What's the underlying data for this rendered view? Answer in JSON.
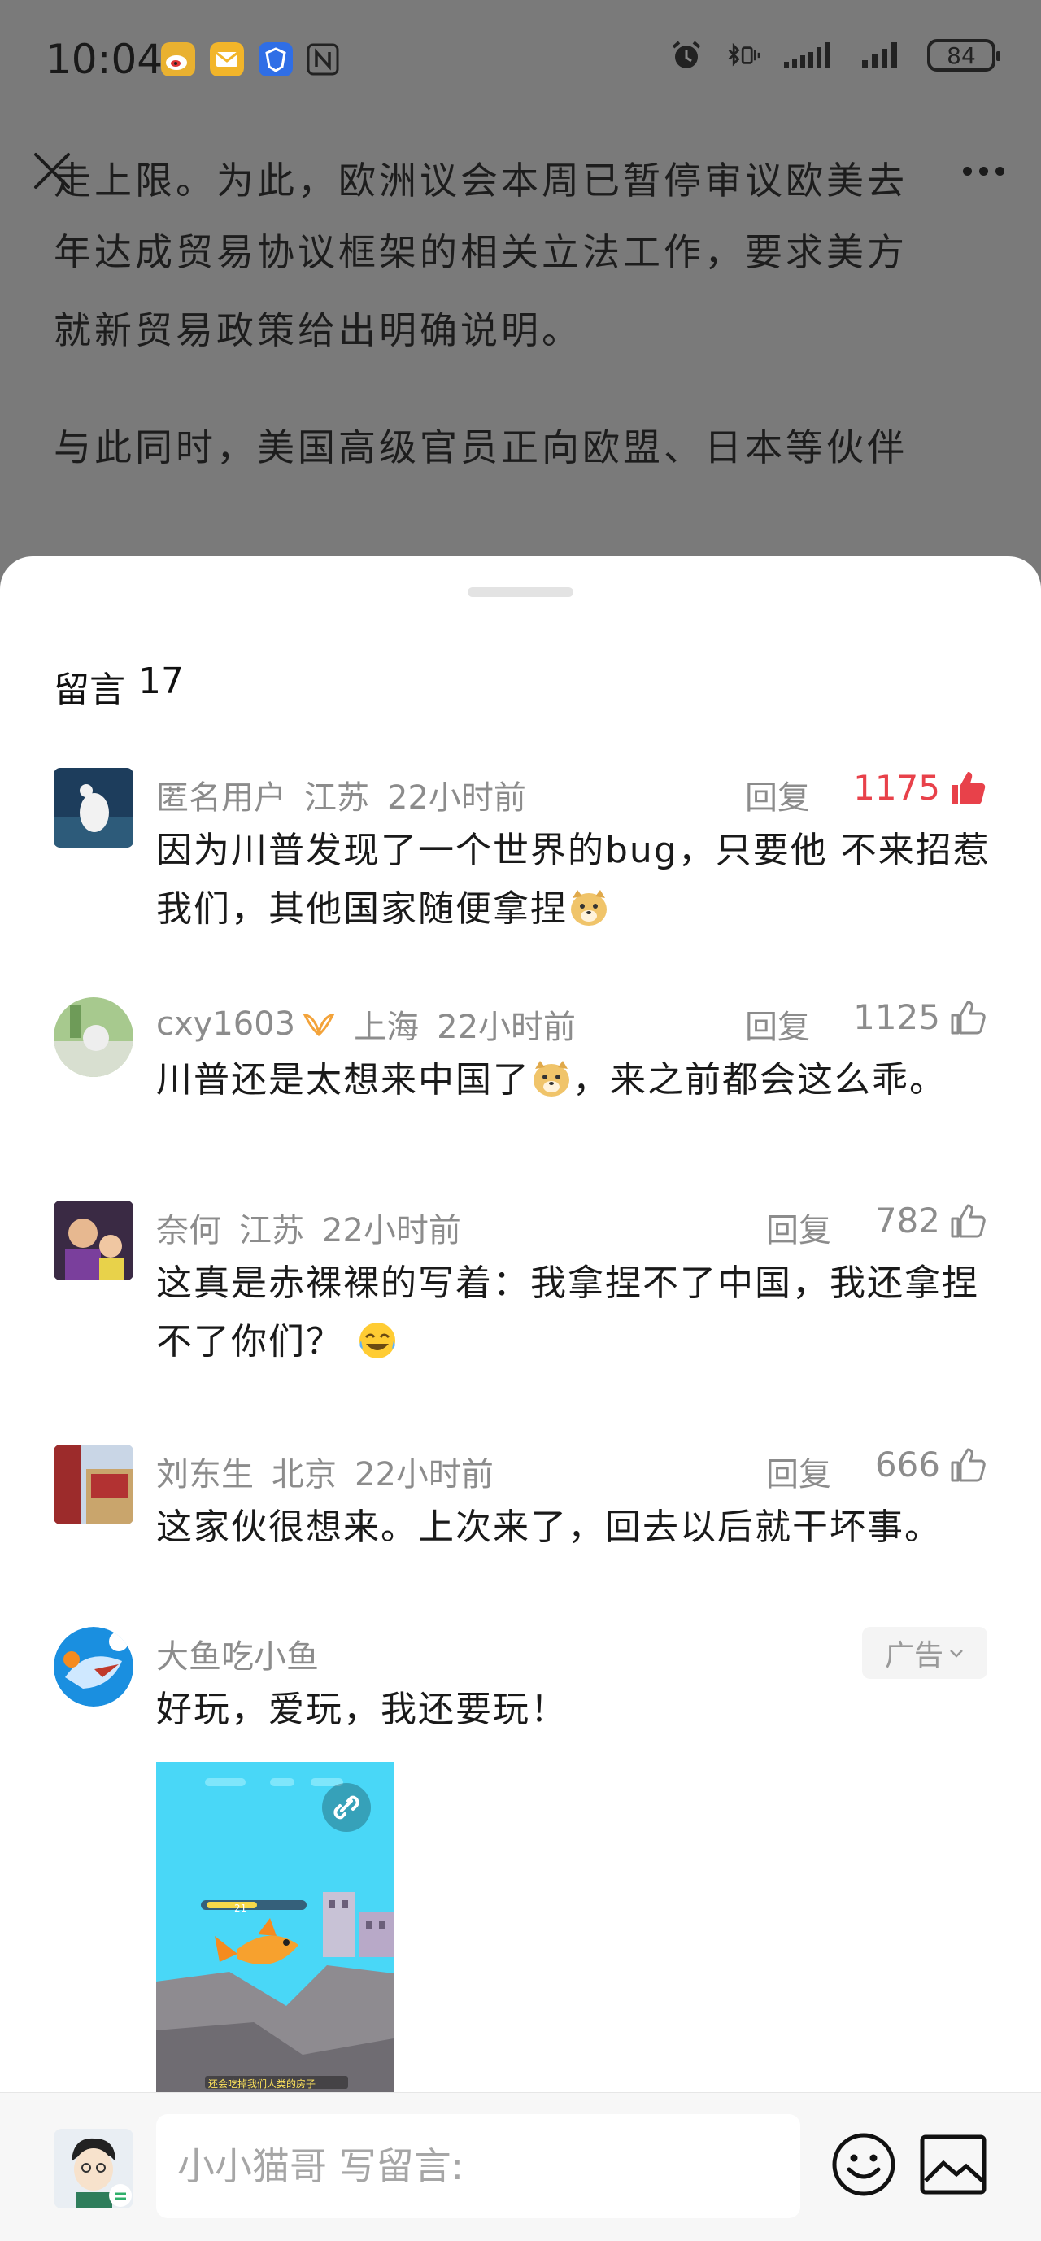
{
  "status": {
    "time": "10:04",
    "battery": "84"
  },
  "article": {
    "cut_line": "走上限。为此，欧洲议会本周已暂停审议欧美去",
    "lines": [
      "年达成贸易协议框架的相关立法工作，要求美方",
      "就新贸易政策给出明确说明。"
    ],
    "para2": "与此同时，美国高级官员正向欧盟、日本等伙伴"
  },
  "sheet": {
    "title": "留言",
    "count": "17"
  },
  "comments": [
    {
      "user": "匿名用户",
      "location": "江苏",
      "time": "22小时前",
      "reply": "回复",
      "likes": "1175",
      "text": "因为川普发现了一个世界的bug，只要他 不来招惹我们，其他国家随便拿捏"
    },
    {
      "user": "cxy1603",
      "location": "上海",
      "time": "22小时前",
      "reply": "回复",
      "likes": "1125",
      "text_a": "川普还是太想来中国了",
      "text_b": "，来之前都会这么乖。"
    },
    {
      "user": "奈何",
      "location": "江苏",
      "time": "22小时前",
      "reply": "回复",
      "likes": "782",
      "text": "这真是赤裸裸的写着：我拿捏不了中国，我还拿捏不了你们？"
    },
    {
      "user": "刘东生",
      "location": "北京",
      "time": "22小时前",
      "reply": "回复",
      "likes": "666",
      "text": "这家伙很想来。上次来了，回去以后就干坏事。"
    }
  ],
  "ad": {
    "name": "大鱼吃小鱼",
    "tag": "广告",
    "text": "好玩，爱玩，我还要玩！",
    "caption": "还会吃掉我们人类的房子",
    "level": "21"
  },
  "input": {
    "placeholder": "小小猫哥 写留言:"
  },
  "colors": {
    "hot_like": "#e8414a",
    "meta": "#8c8c8c",
    "ad_bg": "#49d7f7"
  }
}
